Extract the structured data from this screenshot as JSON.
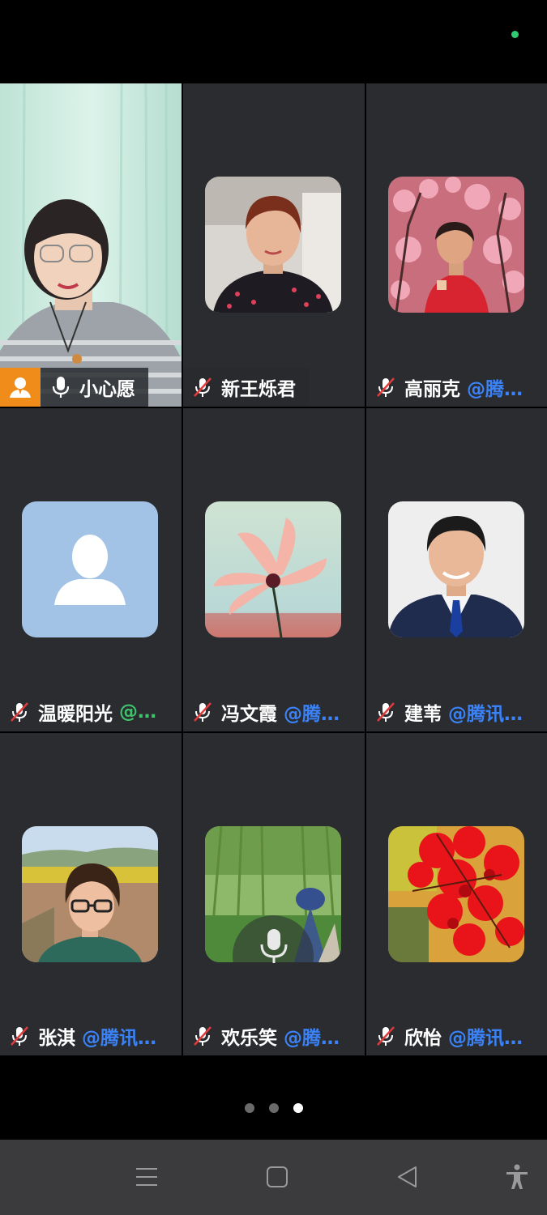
{
  "pagination": {
    "total_pages": 3,
    "current_page": 3
  },
  "participants": [
    {
      "name": "小心愿",
      "org": "",
      "mic": "on",
      "host": true,
      "video": true
    },
    {
      "name": "新王烁君",
      "org": "",
      "mic": "muted"
    },
    {
      "name": "高丽克",
      "org": "@腾…",
      "mic": "muted"
    },
    {
      "name": "温暖阳光",
      "org": "@…",
      "org_color": "#3ec46d",
      "mic": "muted"
    },
    {
      "name": "冯文霞",
      "org": "@腾…",
      "mic": "muted"
    },
    {
      "name": "建苇",
      "org": "@腾讯…",
      "mic": "muted"
    },
    {
      "name": "张淇",
      "org": "@腾讯…",
      "mic": "muted"
    },
    {
      "name": "欢乐笑",
      "org": "@腾…",
      "mic": "muted",
      "speaking_indicator": "mic-icon"
    },
    {
      "name": "欣怡",
      "org": "@腾讯…",
      "mic": "muted"
    }
  ],
  "navbar": {
    "items": [
      "menu-icon",
      "home-icon",
      "back-icon",
      "accessibility-icon"
    ]
  },
  "colors": {
    "host_badge": "#f08c1a",
    "org_link": "#3b82f6",
    "status_dot": "#2ecc71",
    "tile_bg": "#2a2c30"
  }
}
